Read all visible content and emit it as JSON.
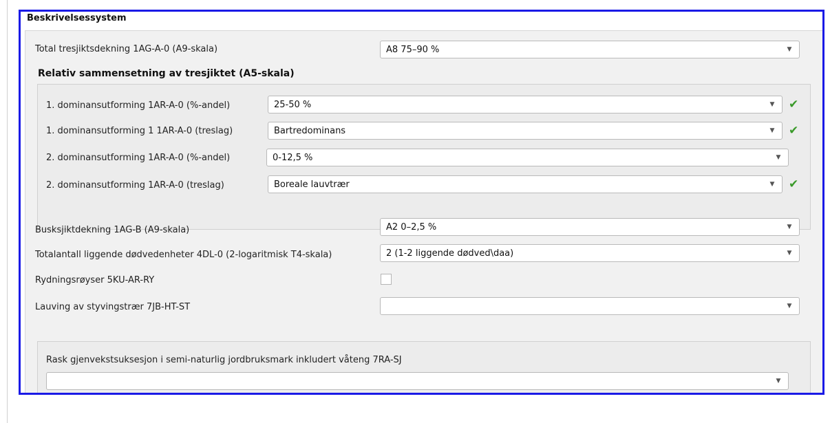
{
  "group": {
    "title": "Beskrivelsessystem"
  },
  "fields": {
    "total_tresjikt": {
      "label": "Total tresjiktsdekning 1AG-A-0 (A9-skala)",
      "value": "A8  75–90 %"
    },
    "relativ_title": "Relativ sammensetning av tresjiktet (A5-skala)",
    "dom1_andel": {
      "label": "1. dominansutforming 1AR-A-0 (%-andel)",
      "value": "25-50 %",
      "valid": true
    },
    "dom1_treslag": {
      "label": "1. dominansutforming 1 1AR-A-0 (treslag)",
      "value": "Bartredominans",
      "valid": true
    },
    "dom2_andel": {
      "label": "2. dominansutforming 1AR-A-0 (%-andel)",
      "value": "0-12,5 %",
      "valid": false
    },
    "dom2_treslag": {
      "label": "2. dominansutforming 1AR-A-0 (treslag)",
      "value": "Boreale lauvtrær",
      "valid": true
    },
    "busksjikt": {
      "label": "Busksjiktdekning 1AG-B (A9-skala)",
      "value": "A2  0–2,5 %"
    },
    "dodved": {
      "label": "Totalantall liggende dødvedenheter 4DL-0 (2-logaritmisk T4-skala)",
      "value": "2 (1-2 liggende dødved\\daa)"
    },
    "rydning": {
      "label": "Rydningsrøyser 5KU-AR-RY",
      "checked": false
    },
    "lauving": {
      "label": "Lauving av styvingstrær 7JB-HT-ST",
      "value": ""
    },
    "rask": {
      "label": "Rask gjenvekstsuksesjon i semi-naturlig jordbruksmark inkludert våteng 7RA-SJ",
      "value": ""
    }
  },
  "icons": {
    "dropdown": "chevron-down-icon",
    "valid": "checkmark-icon"
  },
  "colors": {
    "highlight_border": "#1a1ae6",
    "checkmark": "#3a9a2a"
  }
}
